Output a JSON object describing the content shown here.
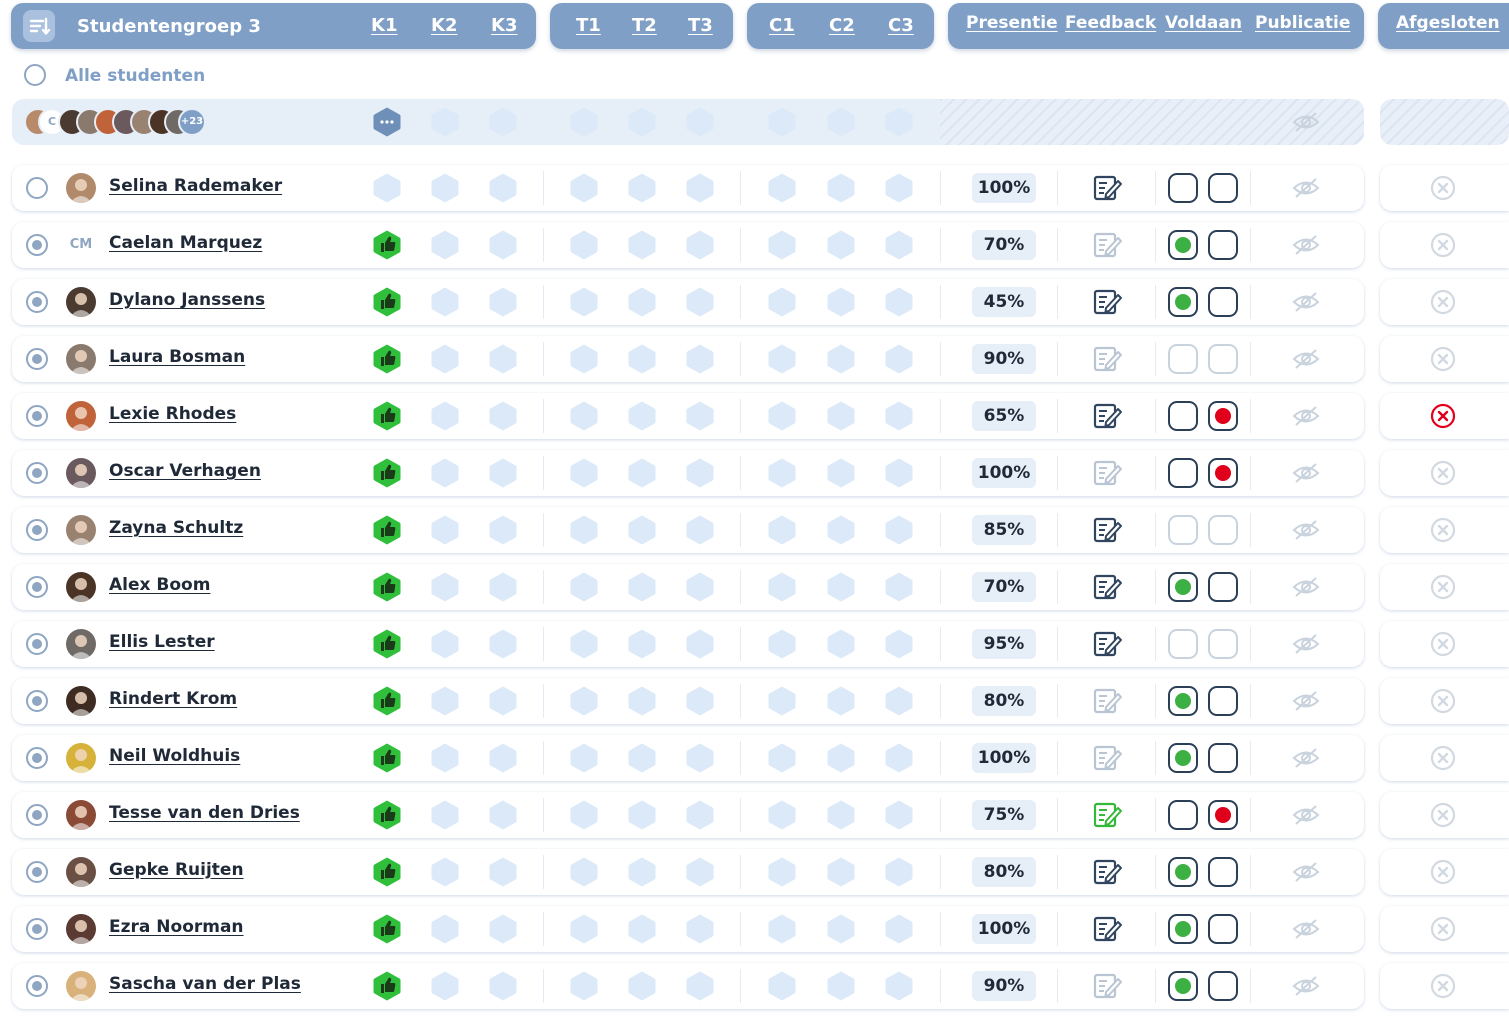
{
  "header": {
    "group_title": "Studentengroep 3",
    "k_cols": [
      "K1",
      "K2",
      "K3"
    ],
    "t_cols": [
      "T1",
      "T2",
      "T3"
    ],
    "c_cols": [
      "C1",
      "C2",
      "C3"
    ],
    "status_cols": [
      "Presentie",
      "Feedback",
      "Voldaan",
      "Publicatie"
    ],
    "closed_col": "Afgesloten"
  },
  "all_students_label": "Alle studenten",
  "summary": {
    "avatar_initials": "C",
    "more_count": "+23"
  },
  "colors": {
    "header": "#7f9fc6",
    "hex_empty": "#dbe9f8",
    "hex_green": "#2fbf3b",
    "hex_gray": "#6e8fb8",
    "dot_green": "#3cb043",
    "dot_red": "#e0001b",
    "edit_green": "#35b83a",
    "edit_dark": "#31465e",
    "edit_faint": "#b9c5d3",
    "x_red": "#e0001b",
    "x_faint": "#d3d9e0"
  },
  "students": [
    {
      "name": "Selina Rademaker",
      "initials": "",
      "checked": false,
      "k1": "empty",
      "presence": "100%",
      "feedback": "dark",
      "voldaan": [
        "empty",
        "empty"
      ],
      "voldaan_style": "dark",
      "closed": "faint",
      "avatar_color": "#b08a6a"
    },
    {
      "name": "Caelan Marquez",
      "initials": "CM",
      "checked": true,
      "k1": "thumb",
      "presence": "70%",
      "feedback": "faint",
      "voldaan": [
        "green",
        "empty"
      ],
      "voldaan_style": "dark",
      "closed": "faint",
      "avatar_color": ""
    },
    {
      "name": "Dylano Janssens",
      "initials": "",
      "checked": true,
      "k1": "thumb",
      "presence": "45%",
      "feedback": "dark",
      "voldaan": [
        "green",
        "empty"
      ],
      "voldaan_style": "dark",
      "closed": "faint",
      "avatar_color": "#4a3a30"
    },
    {
      "name": "Laura Bosman",
      "initials": "",
      "checked": true,
      "k1": "thumb",
      "presence": "90%",
      "feedback": "faint",
      "voldaan": [
        "empty",
        "empty"
      ],
      "voldaan_style": "faint",
      "closed": "faint",
      "avatar_color": "#8a7a6e"
    },
    {
      "name": "Lexie Rhodes",
      "initials": "",
      "checked": true,
      "k1": "thumb",
      "presence": "65%",
      "feedback": "dark",
      "voldaan": [
        "empty",
        "red"
      ],
      "voldaan_style": "dark",
      "closed": "red",
      "avatar_color": "#c0623a"
    },
    {
      "name": "Oscar Verhagen",
      "initials": "",
      "checked": true,
      "k1": "thumb",
      "presence": "100%",
      "feedback": "faint",
      "voldaan": [
        "empty",
        "red"
      ],
      "voldaan_style": "dark",
      "closed": "faint",
      "avatar_color": "#6a5a5e"
    },
    {
      "name": "Zayna Schultz",
      "initials": "",
      "checked": true,
      "k1": "thumb",
      "presence": "85%",
      "feedback": "dark",
      "voldaan": [
        "empty",
        "empty"
      ],
      "voldaan_style": "faint",
      "closed": "faint",
      "avatar_color": "#9a8270"
    },
    {
      "name": "Alex Boom",
      "initials": "",
      "checked": true,
      "k1": "thumb",
      "presence": "70%",
      "feedback": "dark",
      "voldaan": [
        "green",
        "empty"
      ],
      "voldaan_style": "dark",
      "closed": "faint",
      "avatar_color": "#4b3426"
    },
    {
      "name": "Ellis Lester",
      "initials": "",
      "checked": true,
      "k1": "thumb",
      "presence": "95%",
      "feedback": "dark",
      "voldaan": [
        "empty",
        "empty"
      ],
      "voldaan_style": "faint",
      "closed": "faint",
      "avatar_color": "#6f6a66"
    },
    {
      "name": "Rindert Krom",
      "initials": "",
      "checked": true,
      "k1": "thumb",
      "presence": "80%",
      "feedback": "faint",
      "voldaan": [
        "green",
        "empty"
      ],
      "voldaan_style": "dark",
      "closed": "faint",
      "avatar_color": "#3e2c22"
    },
    {
      "name": "Neil Woldhuis",
      "initials": "",
      "checked": true,
      "k1": "thumb",
      "presence": "100%",
      "feedback": "faint",
      "voldaan": [
        "green",
        "empty"
      ],
      "voldaan_style": "dark",
      "closed": "faint",
      "avatar_color": "#d6b23a"
    },
    {
      "name": "Tesse van den Dries",
      "initials": "",
      "checked": true,
      "k1": "thumb",
      "presence": "75%",
      "feedback": "green",
      "voldaan": [
        "empty",
        "red"
      ],
      "voldaan_style": "dark",
      "closed": "faint",
      "avatar_color": "#8a4a36"
    },
    {
      "name": "Gepke Ruijten",
      "initials": "",
      "checked": true,
      "k1": "thumb",
      "presence": "80%",
      "feedback": "dark",
      "voldaan": [
        "green",
        "empty"
      ],
      "voldaan_style": "dark",
      "closed": "faint",
      "avatar_color": "#6a5044"
    },
    {
      "name": "Ezra Noorman",
      "initials": "",
      "checked": true,
      "k1": "thumb",
      "presence": "100%",
      "feedback": "dark",
      "voldaan": [
        "green",
        "empty"
      ],
      "voldaan_style": "dark",
      "closed": "faint",
      "avatar_color": "#5a3a32"
    },
    {
      "name": "Sascha van der Plas",
      "initials": "",
      "checked": true,
      "k1": "thumb",
      "presence": "90%",
      "feedback": "faint",
      "voldaan": [
        "green",
        "empty"
      ],
      "voldaan_style": "dark",
      "closed": "faint",
      "avatar_color": "#d8b27a"
    }
  ]
}
